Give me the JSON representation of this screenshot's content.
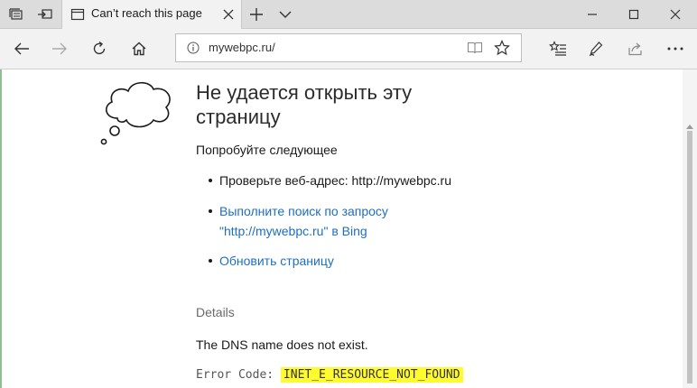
{
  "tab": {
    "title": "Can’t reach this page"
  },
  "address_bar": {
    "url": "mywebpc.ru/"
  },
  "error_page": {
    "heading": "Не удается открыть эту страницу",
    "try_label": "Попробуйте следующее",
    "suggestions": [
      {
        "text": "Проверьте веб-адрес: http://mywebpc.ru",
        "is_link": false
      },
      {
        "text": "Выполните поиск по запросу \"http://mywebpc.ru\" в Bing",
        "is_link": true
      },
      {
        "text": "Обновить страницу",
        "is_link": true
      }
    ],
    "details_label": "Details",
    "details_text": "The DNS name does not exist.",
    "error_code_label": "Error Code:",
    "error_code": "INET_E_RESOURCE_NOT_FOUND"
  },
  "colors": {
    "link": "#1e6fc0",
    "highlight": "#fffb2e"
  }
}
